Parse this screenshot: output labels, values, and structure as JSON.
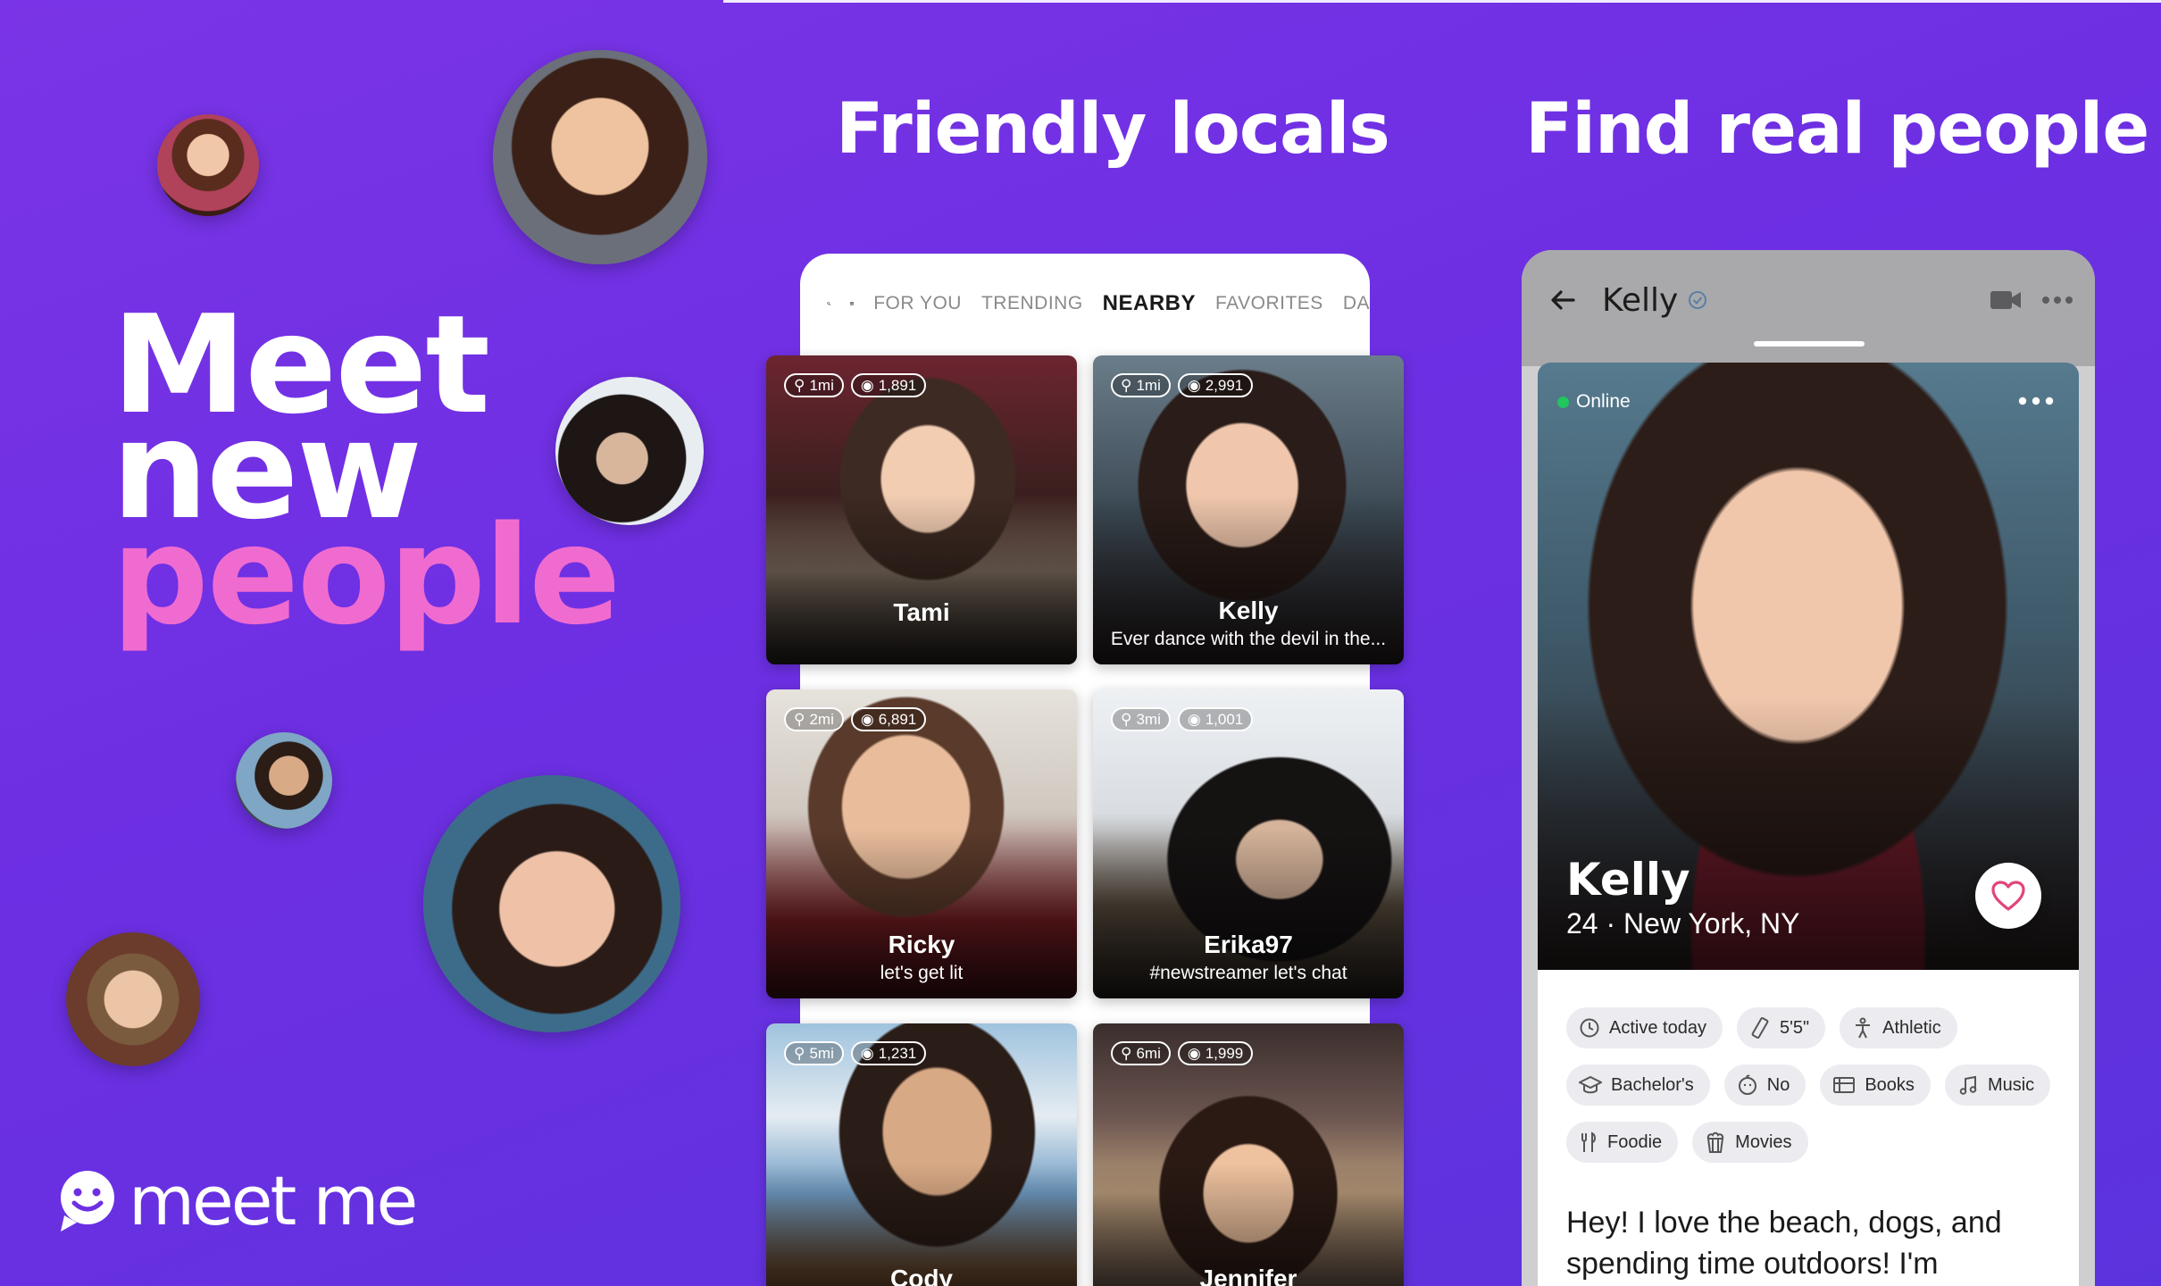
{
  "left": {
    "headline": {
      "line1": "Meet",
      "line2": "new",
      "line3": "people"
    },
    "logo_text": "meet me"
  },
  "titles": {
    "middle": "Friendly locals",
    "right": "Find real people"
  },
  "nearby": {
    "tabs": [
      {
        "label": "FOR YOU",
        "active": false
      },
      {
        "label": "TRENDING",
        "active": false
      },
      {
        "label": "NEARBY",
        "active": true
      },
      {
        "label": "FAVORITES",
        "active": false
      },
      {
        "label": "DA",
        "active": false
      }
    ],
    "cards": [
      {
        "name": "Tami",
        "bio": "",
        "distance": "1mi",
        "views": "1,891"
      },
      {
        "name": "Kelly",
        "bio": "Ever dance with the devil in the...",
        "distance": "1mi",
        "views": "2,991"
      },
      {
        "name": "Ricky",
        "bio": "let's get lit",
        "distance": "2mi",
        "views": "6,891"
      },
      {
        "name": "Erika97",
        "bio": "#newstreamer let's chat",
        "distance": "3mi",
        "views": "1,001"
      },
      {
        "name": "Cody",
        "bio": "",
        "distance": "5mi",
        "views": "1,231"
      },
      {
        "name": "Jennifer",
        "bio": "",
        "distance": "6mi",
        "views": "1,999"
      }
    ]
  },
  "profile": {
    "header_name": "Kelly",
    "status": "Online",
    "name": "Kelly",
    "subtitle": "24 · New York, NY",
    "tags": [
      {
        "icon": "clock-icon",
        "label": "Active today"
      },
      {
        "icon": "ruler-icon",
        "label": "5'5\""
      },
      {
        "icon": "body-icon",
        "label": "Athletic"
      },
      {
        "icon": "graduation-cap-icon",
        "label": "Bachelor's"
      },
      {
        "icon": "baby-icon",
        "label": "No"
      },
      {
        "icon": "book-icon",
        "label": "Books"
      },
      {
        "icon": "music-note-icon",
        "label": "Music"
      },
      {
        "icon": "fork-knife-icon",
        "label": "Foodie"
      },
      {
        "icon": "popcorn-icon",
        "label": "Movies"
      }
    ],
    "bio": "Hey! I love the beach, dogs, and spending time outdoors! I'm"
  },
  "colors": {
    "background": "#6e2fe3",
    "accent_pink": "#f06bd0",
    "heart": "#e2457a",
    "online": "#22c55e"
  }
}
